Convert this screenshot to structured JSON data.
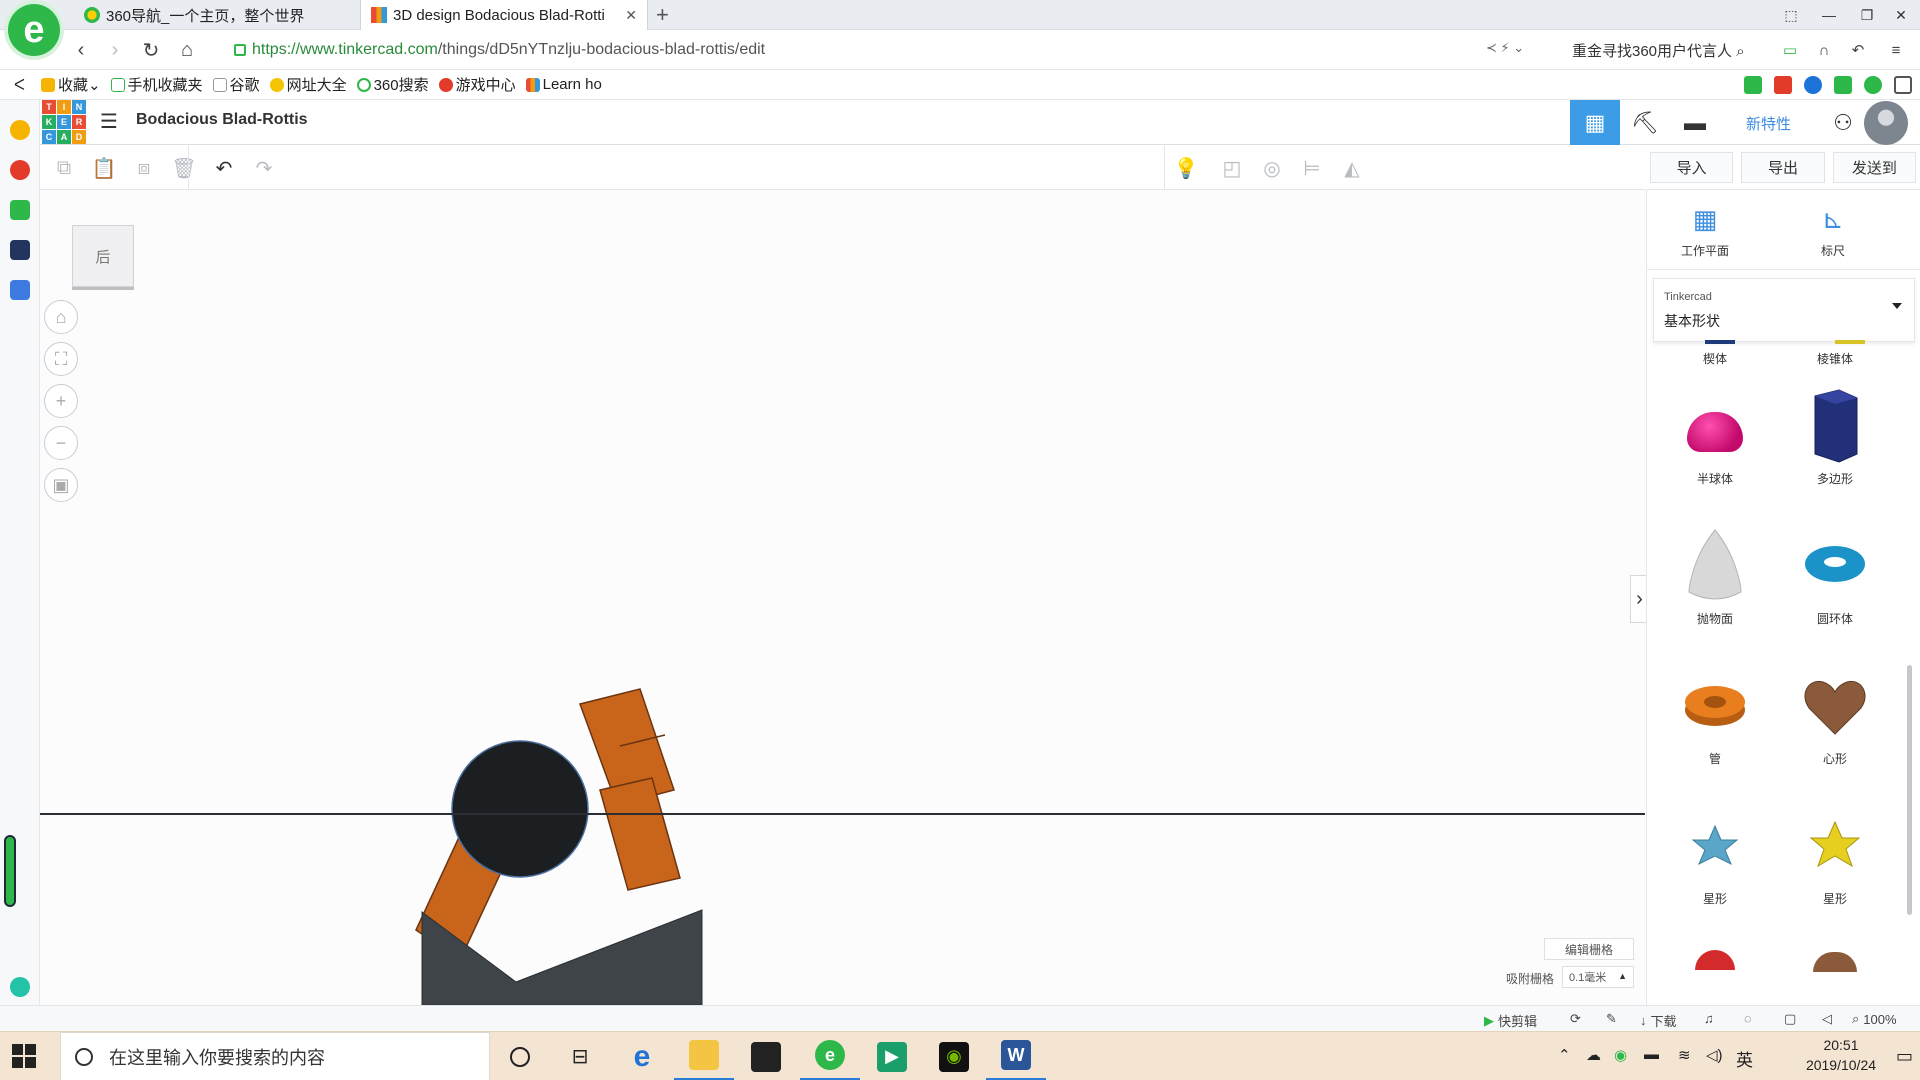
{
  "browser": {
    "tabs": [
      {
        "title": "360导航_一个主页，整个世界",
        "active": false
      },
      {
        "title": "3D design Bodacious Blad-Rotti",
        "active": true
      }
    ],
    "url_domain": "https://www.tinkercad.com",
    "url_path": "/things/dD5nYTnzlju-bodacious-blad-rottis/edit",
    "promo_text": "重金寻找360用户代言人",
    "bookmarks": [
      "收藏",
      "手机收藏夹",
      "谷歌",
      "网址大全",
      "360搜索",
      "游戏中心",
      "Learn ho"
    ]
  },
  "tinkercad": {
    "project_title": "Bodacious Blad-Rottis",
    "new_features_label": "新特性",
    "import_label": "导入",
    "export_label": "导出",
    "send_label": "发送到",
    "viewcube_label": "后",
    "workplane_label": "工作平面",
    "ruler_label": "标尺",
    "library_source": "Tinkercad",
    "library_name": "基本形状",
    "edit_grid_label": "编辑栅格",
    "snap_grid_label": "吸附栅格",
    "snap_grid_value": "0.1毫米",
    "shapes": [
      {
        "name": "楔体",
        "color": "#1f3a7a"
      },
      {
        "name": "棱锥体",
        "color": "#d9c428"
      },
      {
        "name": "半球体",
        "color": "#e0127f"
      },
      {
        "name": "多边形",
        "color": "#22307a"
      },
      {
        "name": "抛物面",
        "color": "#d8d8d8"
      },
      {
        "name": "圆环体",
        "color": "#1b93c8"
      },
      {
        "name": "管",
        "color": "#e87e1e"
      },
      {
        "name": "心形",
        "color": "#8a5a3a"
      },
      {
        "name": "星形",
        "color": "#5aa6c8"
      },
      {
        "name": "星形",
        "color": "#e6cf1f"
      }
    ],
    "colors": {
      "accent": "#3d9ce6",
      "arm": "#c9651b",
      "base": "#3f4448",
      "ball": "#1c1f22"
    }
  },
  "statusbar": {
    "clip_label": "快剪辑",
    "download_label": "下载",
    "zoom": "100%"
  },
  "taskbar": {
    "search_placeholder": "在这里输入你要搜索的内容",
    "ime": "英",
    "time": "20:51",
    "date": "2019/10/24"
  }
}
